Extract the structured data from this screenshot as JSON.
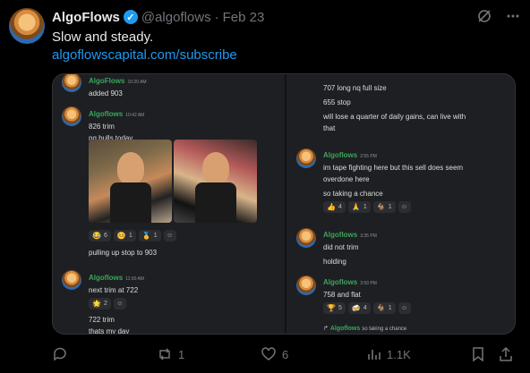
{
  "tweet": {
    "name": "AlgoFlows",
    "handle": "@algoflows",
    "separator": "·",
    "date": "Feb 23",
    "text": "Slow and steady.",
    "link": "algoflowscapital.com/subscribe"
  },
  "discord_left": [
    {
      "user": "AlgoFlows",
      "time": "10:20 AM",
      "lines": [
        "added 903"
      ]
    },
    {
      "user": "Algoflows",
      "time": "10:42 AM",
      "lines": [
        "826 trim",
        "nq bulls today"
      ],
      "reactions": [
        {
          "emoji": "😂",
          "count": "6"
        },
        {
          "emoji": "🤒",
          "count": "1"
        },
        {
          "emoji": "🥇",
          "count": "1"
        }
      ],
      "after": "pulling up stop to 903"
    },
    {
      "user": "Algoflows",
      "time": "11:00 AM",
      "lines": [
        "next trim at 722"
      ],
      "reactions": [
        {
          "emoji": "🌟",
          "count": "2"
        }
      ],
      "after_lines": [
        "722 trim",
        "thats my day"
      ]
    }
  ],
  "discord_right": [
    {
      "lines": [
        "707 long nq full size",
        "655 stop",
        "will lose a quarter of daily gains, can live with",
        "that"
      ]
    },
    {
      "user": "Algoflows",
      "time": "2:55 PM",
      "lines": [
        "im tape fighting here but this sell does seem",
        "overdone here",
        "so taking a chance"
      ],
      "reactions": [
        {
          "emoji": "👍",
          "count": "4"
        },
        {
          "emoji": "🙏",
          "count": "1"
        },
        {
          "emoji": "🐐",
          "count": "1"
        }
      ]
    },
    {
      "user": "Algoflows",
      "time": "3:35 PM",
      "lines": [
        "did not trim",
        "holding"
      ]
    },
    {
      "user": "Algoflows",
      "time": "3:59 PM",
      "lines": [
        "758 and flat"
      ],
      "reactions": [
        {
          "emoji": "🏆",
          "count": "5"
        },
        {
          "emoji": "🍻",
          "count": "4"
        },
        {
          "emoji": "🐐",
          "count": "1"
        }
      ]
    },
    {
      "reply_user": "Algoflows",
      "reply_text": "so taking a chance"
    }
  ],
  "actions": {
    "replies": "",
    "retweets": "1",
    "likes": "6",
    "views": "1.1K"
  },
  "colors": {
    "link": "#1d9bf0",
    "discord_user": "#3ba55d",
    "muted": "#71767b"
  }
}
